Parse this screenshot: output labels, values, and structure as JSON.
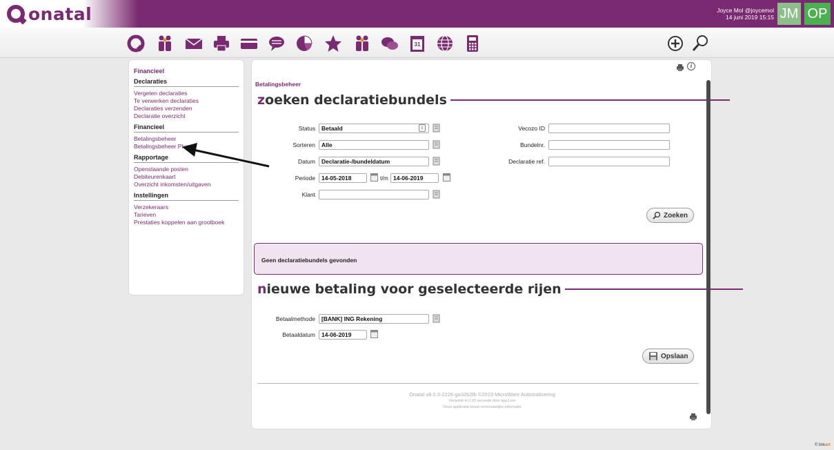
{
  "app": {
    "logo_text": "onatal"
  },
  "user": {
    "name": "Joyce Mol @joycemol",
    "datetime": "14 juni 2019 15:15",
    "avatar1": "JM",
    "avatar2": "OP"
  },
  "toolbar": {
    "icons": [
      "home-icon",
      "persons-icon",
      "mail-icon",
      "print-icon",
      "card-icon",
      "chat-icon",
      "pie-chart-icon",
      "star-icon",
      "group-icon",
      "talk-icon",
      "calendar-icon",
      "globe-icon",
      "calculator-icon"
    ],
    "right_icons": [
      "add-icon",
      "search-icon"
    ]
  },
  "sidebar": {
    "title": "Financieel",
    "sections": [
      {
        "heading": "Declaraties",
        "items": [
          "Vergeten declaraties",
          "Te verwerken declaraties",
          "Declaraties verzenden",
          "Declaratie overzicht"
        ]
      },
      {
        "heading": "Financieel",
        "items": [
          "Betalingsbeheer",
          "Betalingsbeheer Plus"
        ]
      },
      {
        "heading": "Rapportage",
        "items": [
          "Openstaande posten",
          "Debiteurenkaart",
          "Overzicht inkomsten/uitgaven"
        ]
      },
      {
        "heading": "Instellingen",
        "items": [
          "Verzekeraars",
          "Tarieven",
          "Prestaties koppelen aan grootboek"
        ]
      }
    ]
  },
  "main": {
    "breadcrumb": "Betalingsbeheer",
    "search_title_first": "z",
    "search_title_rest": "oeken declaratiebundels",
    "form": {
      "status_label": "Status",
      "status_value": "Betaald",
      "sorteren_label": "Sorteren",
      "sorteren_value": "Alle",
      "datum_label": "Datum",
      "datum_value": "Declaratie-/bundeldatum",
      "periode_label": "Periode",
      "periode_from": "14-05-2018",
      "periode_sep": "t/m",
      "periode_to": "14-06-2019",
      "klant_label": "Klant",
      "klant_value": "",
      "vecozo_label": "Vecozo ID",
      "bundelnr_label": "Bundelnr.",
      "declref_label": "Declaratie ref."
    },
    "search_button": "Zoeken",
    "results_text": "Geen declaratiebundels gevonden",
    "payment_title_first": "n",
    "payment_title_rest": "ieuwe betaling voor geselecteerde rijen",
    "payment": {
      "method_label": "Betaalmethode",
      "method_value": "[BANK] ING Rekening",
      "date_label": "Betaaldatum",
      "date_value": "14-06-2019"
    },
    "save_button": "Opslaan",
    "footer": {
      "line1": "Onatal v8.0.3-2226-ga32b2fb ©2019 MicroWare Automatisering",
      "line2": "Verwerkt in 0.93 seconde door app1:ion",
      "line3": "Deze applicatie bevat vertrouwelijke informatie"
    }
  },
  "watermark": {
    "prefix": "© link",
    "suffix": "art"
  },
  "colors": {
    "brand": "#7a2a70",
    "results_bg": "#f1e4f0"
  }
}
